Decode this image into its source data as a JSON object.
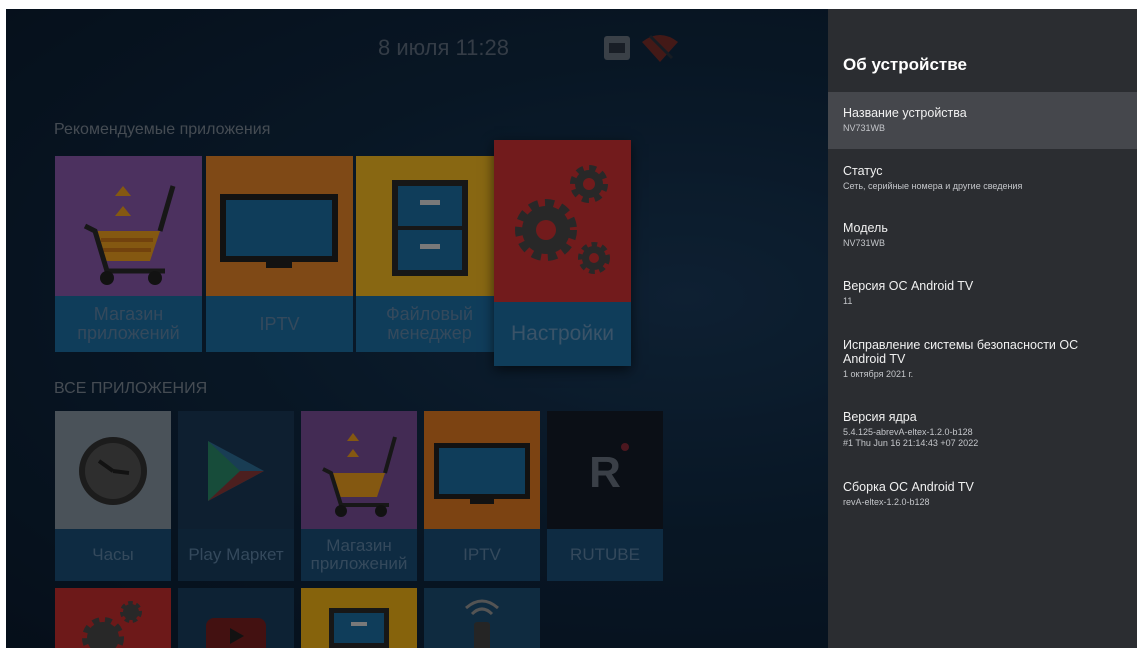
{
  "status_bar": {
    "time": "8 июля 11:28",
    "ethernet_icon": "ethernet-icon",
    "wifi_icon": "wifi-off-icon"
  },
  "sections": {
    "recommended": "Рекомендуемые приложения",
    "all_apps": "ВСЕ ПРИЛОЖЕНИЯ"
  },
  "recommended_apps": [
    {
      "label": "Магазин приложений",
      "icon": "cart-icon",
      "color": "#7a4f9a"
    },
    {
      "label": "IPTV",
      "icon": "tv-icon",
      "color": "#e27b22"
    },
    {
      "label": "Файловый менеджер",
      "icon": "cabinet-icon",
      "color": "#f5b417"
    },
    {
      "label": "Настройки",
      "icon": "gears-icon",
      "color": "#c62e2f",
      "focused": true
    }
  ],
  "all_apps": [
    {
      "label": "Часы",
      "icon": "clock-icon"
    },
    {
      "label": "Play Маркет",
      "icon": "play-store-icon"
    },
    {
      "label": "Магазин приложений",
      "icon": "cart-icon"
    },
    {
      "label": "IPTV",
      "icon": "tv-icon"
    },
    {
      "label": "RUTUBE",
      "icon": "rutube-icon"
    }
  ],
  "settings_panel": {
    "title": "Об устройстве",
    "items": [
      {
        "title": "Название устройства",
        "subtitle": "NV731WB",
        "selected": true
      },
      {
        "title": "Статус",
        "subtitle": "Сеть, серийные номера и другие сведения"
      },
      {
        "title": "Модель",
        "subtitle": "NV731WB"
      },
      {
        "title": "Версия ОС Android TV",
        "subtitle": "11"
      },
      {
        "title": "Исправление системы безопасности ОС Android TV",
        "subtitle": "1 октября 2021 г."
      },
      {
        "title": "Версия ядра",
        "subtitle": "5.4.125-abrevA-eltex-1.2.0-b128\n#1 Thu Jun 16 21:14:43 +07 2022"
      },
      {
        "title": "Сборка ОС Android TV",
        "subtitle": "revA-eltex-1.2.0-b128"
      }
    ]
  }
}
